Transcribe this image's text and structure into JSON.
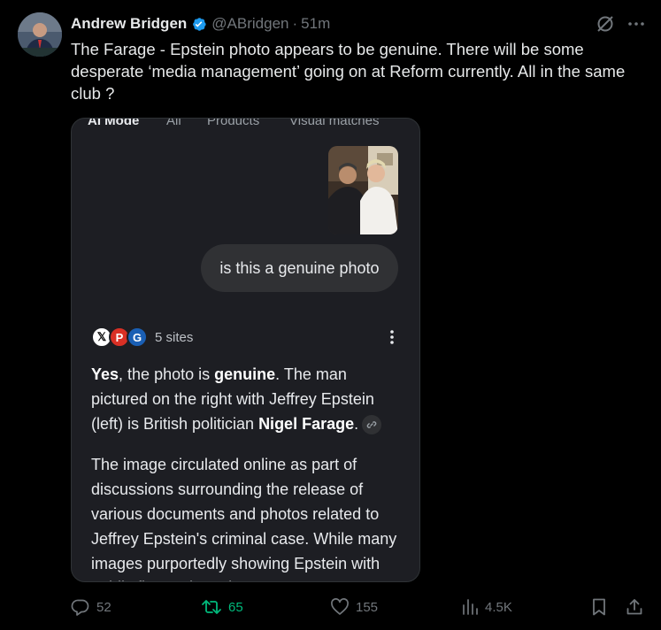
{
  "post": {
    "author_name": "Andrew Bridgen",
    "handle": "@ABridgen",
    "separator": "·",
    "time": "51m",
    "text": "The Farage - Epstein photo appears to be genuine. There will be some desperate ‘media management’ going on at Reform currently. All in the same club ?"
  },
  "screenshot": {
    "tabs": [
      "AI Mode",
      "All",
      "Products",
      "Visual matches"
    ],
    "question": "is this a genuine photo",
    "sources_count": "5 sites",
    "answer": {
      "p1_a": "Yes",
      "p1_b": ", the photo is ",
      "p1_c": "genuine",
      "p1_d": ". The man pictured on the right with Jeffrey Epstein (left) is British politician ",
      "p1_e": "Nigel Farage",
      "p1_f": ".",
      "p2": "The image circulated online as part of discussions surrounding the release of various documents and photos related to Jeffrey Epstein's criminal case. While many images purportedly showing Epstein with public figures have been"
    }
  },
  "actions": {
    "replies": "52",
    "reposts": "65",
    "likes": "155",
    "views": "4.5K"
  },
  "colors": {
    "background": "#000000",
    "verified": "#1d9bf0",
    "repost_active": "#00ba7c",
    "muted": "#71767b"
  }
}
